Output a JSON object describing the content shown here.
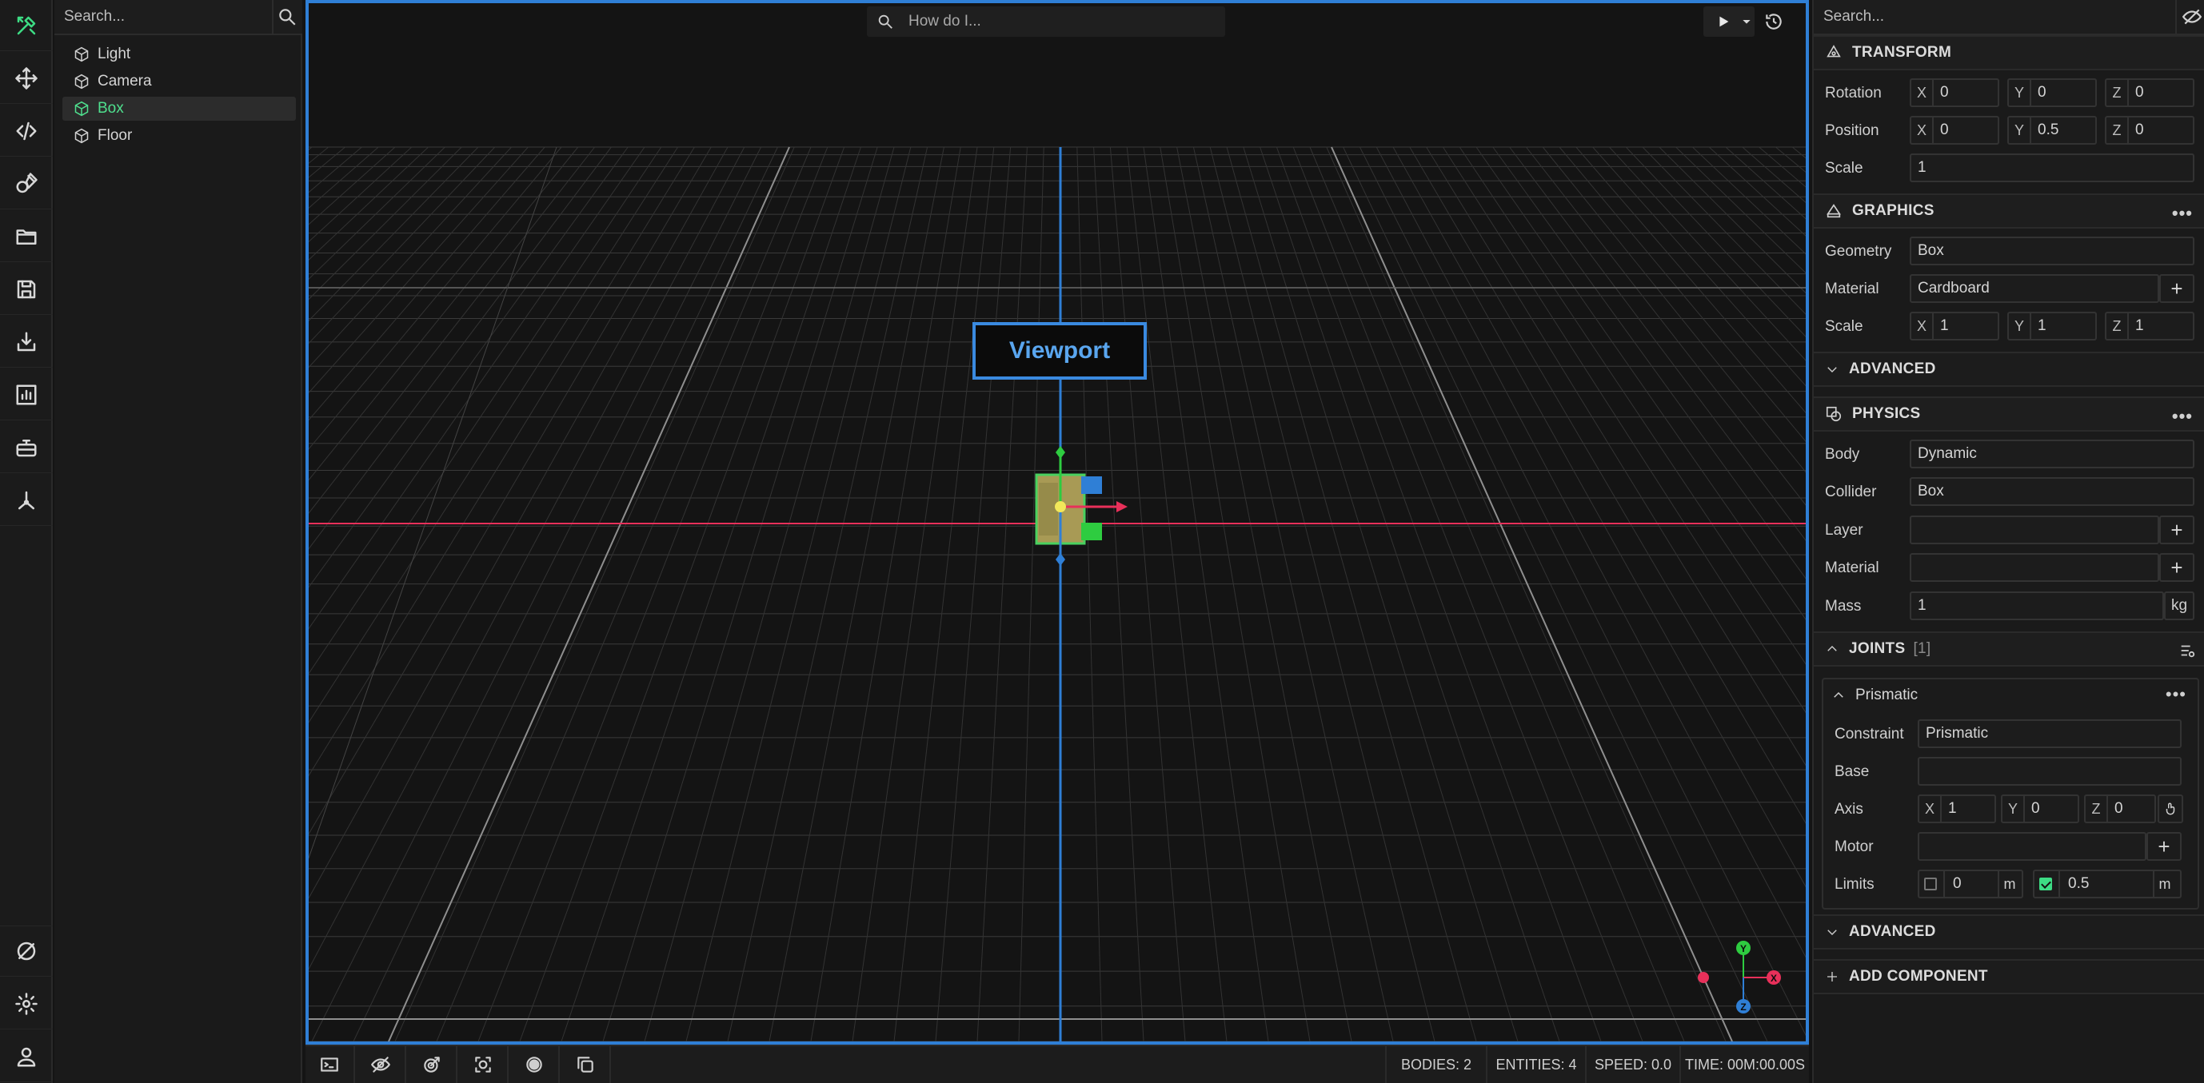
{
  "scene": {
    "search_placeholder": "Search...",
    "items": [
      {
        "label": "Light"
      },
      {
        "label": "Camera"
      },
      {
        "label": "Box",
        "selected": true
      },
      {
        "label": "Floor"
      }
    ]
  },
  "viewport": {
    "search_placeholder": "How do I...",
    "label": "Viewport",
    "gizmo": {
      "y": "Y",
      "x": "X",
      "z": "Z"
    }
  },
  "status": {
    "bodies": "BODIES: 2",
    "entities": "ENTITIES: 4",
    "speed": "SPEED: 0.0",
    "time": "TIME: 00M:00.00S"
  },
  "inspector": {
    "search_placeholder": "Search...",
    "transform": {
      "title": "TRANSFORM",
      "rotation_label": "Rotation",
      "rotation": {
        "x": "0",
        "y": "0",
        "z": "0"
      },
      "position_label": "Position",
      "position": {
        "x": "0",
        "y": "0.5",
        "z": "0"
      },
      "scale_label": "Scale",
      "scale": "1"
    },
    "graphics": {
      "title": "GRAPHICS",
      "geometry_label": "Geometry",
      "geometry": "Box",
      "material_label": "Material",
      "material": "Cardboard",
      "scale_label": "Scale",
      "scale": {
        "x": "1",
        "y": "1",
        "z": "1"
      },
      "advanced": "ADVANCED"
    },
    "physics": {
      "title": "PHYSICS",
      "body_label": "Body",
      "body": "Dynamic",
      "collider_label": "Collider",
      "collider": "Box",
      "layer_label": "Layer",
      "layer": "",
      "material_label": "Material",
      "material": "",
      "mass_label": "Mass",
      "mass": "1",
      "mass_unit": "kg"
    },
    "joints": {
      "title": "JOINTS",
      "count": "[1]",
      "joint_name": "Prismatic",
      "constraint_label": "Constraint",
      "constraint": "Prismatic",
      "base_label": "Base",
      "base": "",
      "axis_label": "Axis",
      "axis": {
        "x": "1",
        "y": "0",
        "z": "0"
      },
      "motor_label": "Motor",
      "motor": "",
      "limits_label": "Limits",
      "limit_min": "0",
      "limit_max": "0.5",
      "limit_unit": "m",
      "limit_min_enabled": false,
      "limit_max_enabled": true
    },
    "advanced": "ADVANCED",
    "add_component": "ADD COMPONENT"
  },
  "axis_letters": {
    "x": "X",
    "y": "Y",
    "z": "Z"
  },
  "colors": {
    "accent": "#3ddc84",
    "viewport_border": "#2f7fd6",
    "axis_x": "#e8305a",
    "axis_y": "#2ecc40",
    "axis_z": "#2f7fd6"
  }
}
